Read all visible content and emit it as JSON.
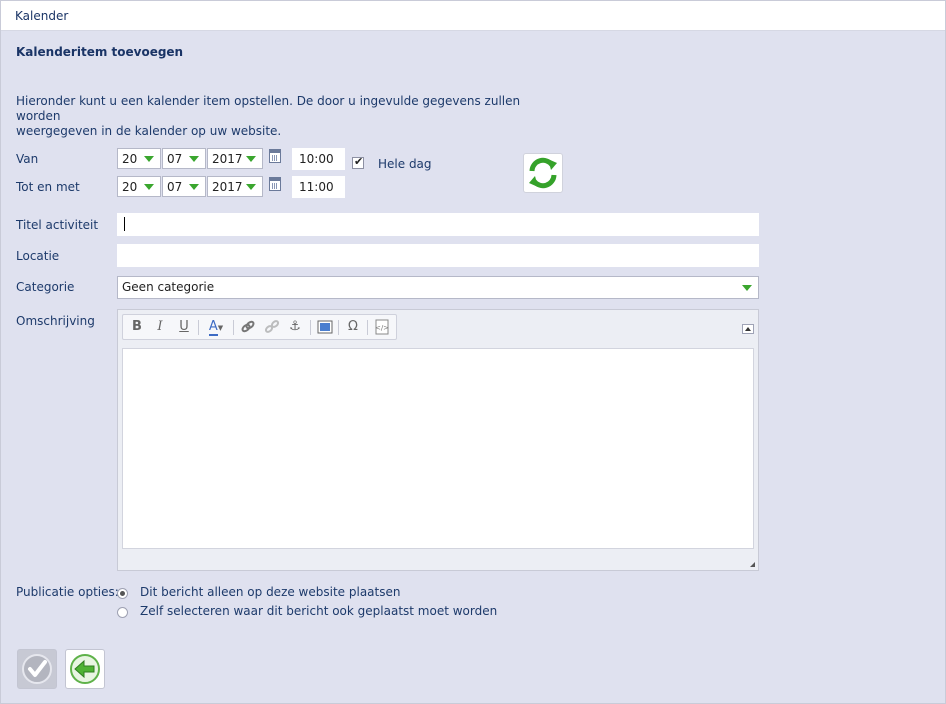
{
  "window": {
    "title": "Kalender"
  },
  "page": {
    "heading": "Kalenderitem toevoegen",
    "intro_line1": "Hieronder kunt u een kalender item opstellen. De door u ingevulde gegevens zullen worden",
    "intro_line2": "weergegeven in de kalender op uw website."
  },
  "from": {
    "label": "Van",
    "day": "20",
    "month": "07",
    "year": "2017",
    "time": "10:00"
  },
  "until": {
    "label": "Tot en met",
    "day": "20",
    "month": "07",
    "year": "2017",
    "time": "11:00"
  },
  "all_day": {
    "label": "Hele dag",
    "checked": true
  },
  "fields": {
    "title_label": "Titel activiteit",
    "title_value": "",
    "location_label": "Locatie",
    "location_value": "",
    "category_label": "Categorie",
    "category_value": "Geen categorie",
    "description_label": "Omschrijving"
  },
  "toolbar": {
    "bold": "B",
    "italic": "I",
    "underline": "U",
    "fontcolor": "A",
    "link_icon": "link-icon",
    "unlink_icon": "unlink-icon",
    "anchor_icon": "anchor-icon",
    "image_icon": "image-icon",
    "special_char": "Ω",
    "source_icon": "source-icon"
  },
  "publication": {
    "label": "Publicatie opties:",
    "options": [
      {
        "label": "Dit bericht alleen op deze website plaatsen",
        "selected": true
      },
      {
        "label": "Zelf selecteren waar dit bericht ook geplaatst moet worden",
        "selected": false
      }
    ]
  },
  "colors": {
    "accent": "#1a3466",
    "green": "#3aa62e",
    "background": "#dfe1ef"
  }
}
